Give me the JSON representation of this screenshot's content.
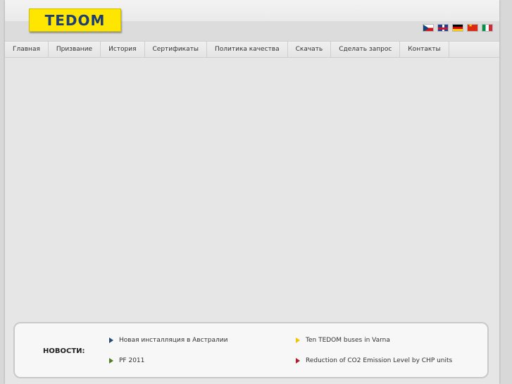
{
  "logo": {
    "text": "TEDOM"
  },
  "languages": [
    {
      "icon": "czech-flag-icon"
    },
    {
      "icon": "uk-flag-icon"
    },
    {
      "icon": "german-flag-icon"
    },
    {
      "icon": "chinese-flag-icon"
    },
    {
      "icon": "italian-flag-icon"
    }
  ],
  "nav": {
    "items": [
      "Главная",
      "Призвание",
      "История",
      "Сертификаты",
      "Политика качества",
      "Скачать",
      "Сделать запрос",
      "Контакты"
    ]
  },
  "news": {
    "title": "НОВОСТИ:",
    "items": [
      {
        "text": "Новая инсталляция в Австралии",
        "marker_color": "#1f4a7a"
      },
      {
        "text": "Ten TEDOM buses in Varna",
        "marker_color": "#f2c500"
      },
      {
        "text": "PF 2011",
        "marker_color": "#4e7f1c"
      },
      {
        "text": "Reduction of CO2 Emission Level by CHP units",
        "marker_color": "#b01e2a"
      }
    ]
  }
}
